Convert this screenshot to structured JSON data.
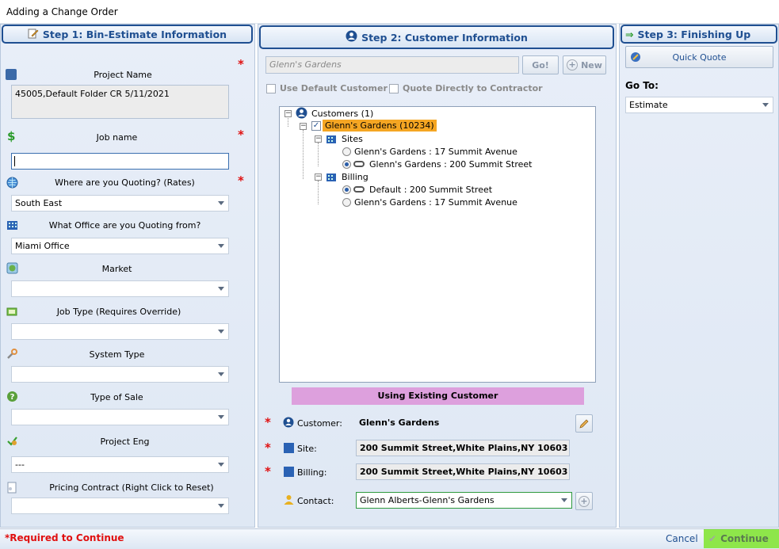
{
  "window": {
    "title": "Adding a Change Order"
  },
  "step1": {
    "title": "Step 1: Bin-Estimate Information",
    "fields": {
      "project_name": {
        "label": "Project Name",
        "value": "45005,Default Folder CR 5/11/2021"
      },
      "job_name": {
        "label": "Job name",
        "value": ""
      },
      "quoting_rates": {
        "label": "Where are you Quoting? (Rates)",
        "value": "South East"
      },
      "office": {
        "label": "What Office are you Quoting from?",
        "value": "Miami Office"
      },
      "market": {
        "label": "Market",
        "value": ""
      },
      "job_type": {
        "label": "Job Type (Requires Override)",
        "value": ""
      },
      "system_type": {
        "label": "System Type",
        "value": ""
      },
      "type_of_sale": {
        "label": "Type of Sale",
        "value": ""
      },
      "project_eng": {
        "label": "Project Eng",
        "value": "---"
      },
      "pricing_contract": {
        "label": "Pricing Contract (Right Click to Reset)",
        "value": ""
      }
    },
    "required_mark": "*"
  },
  "step2": {
    "title": "Step 2: Customer Information",
    "search": {
      "value": "Glenn's Gardens"
    },
    "go_label": "Go!",
    "new_label": "New",
    "use_default_customer": "Use Default Customer",
    "quote_direct": "Quote Directly to Contractor",
    "tree": {
      "root": "Customers  (1)",
      "customer": "Glenn's Gardens (10234)",
      "sites_label": "Sites",
      "sites": [
        "Glenn's Gardens : 17 Summit Avenue",
        "Glenn's Gardens : 200 Summit Street"
      ],
      "billing_label": "Billing",
      "billing": [
        "Default : 200 Summit Street",
        "Glenn's Gardens : 17 Summit Avenue"
      ]
    },
    "status_banner": "Using Existing Customer",
    "customer": {
      "label": "Customer:",
      "value": "Glenn's Gardens"
    },
    "site": {
      "label": "Site:",
      "value": "200 Summit Street,White Plains,NY 10603"
    },
    "billing": {
      "label": "Billing:",
      "value": "200 Summit Street,White Plains,NY 10603"
    },
    "contact": {
      "label": "Contact:",
      "value": "Glenn Alberts-Glenn's Gardens"
    }
  },
  "step3": {
    "title": "Step 3: Finishing Up",
    "quick_quote": "Quick Quote",
    "goto_label": "Go To:",
    "goto_value": "Estimate"
  },
  "footer": {
    "required": "*Required to Continue",
    "cancel": "Cancel",
    "continue": "Continue"
  },
  "colors": {
    "accent": "#1f4f91",
    "required": "#e01010",
    "highlight": "#f5a623",
    "banner": "#dda0dd",
    "continue": "#8ee64a"
  }
}
